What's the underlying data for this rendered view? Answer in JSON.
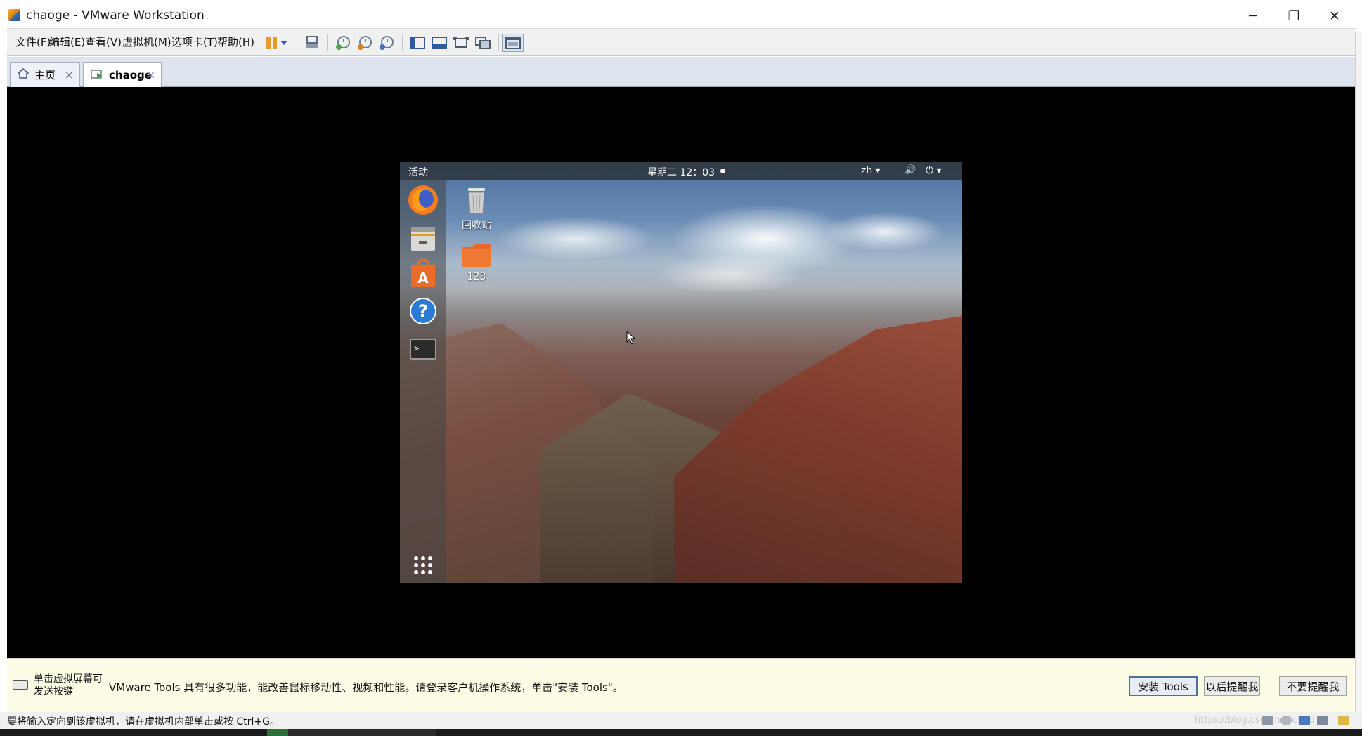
{
  "window": {
    "title": "chaoge - VMware Workstation",
    "controls": {
      "minimize": "─",
      "maximize": "❐",
      "close": "✕"
    }
  },
  "menu": [
    "文件(F)",
    "编辑(E)",
    "查看(V)",
    "虚拟机(M)",
    "选项卡(T)",
    "帮助(H)"
  ],
  "toolbar_icons": [
    "pause-icon",
    "dropdown-arrow-icon",
    "send-ctrl-alt-del-icon",
    "snapshot-take-icon",
    "snapshot-revert-icon",
    "snapshot-manager-icon",
    "library-view-icon",
    "thumbnail-bar-icon",
    "full-screen-icon",
    "unity-icon",
    "console-view-icon"
  ],
  "tabs": [
    {
      "label": "主页",
      "icon": "home-icon",
      "active": false
    },
    {
      "label": "chaoge",
      "icon": "vm-icon",
      "active": true
    }
  ],
  "guest": {
    "topbar": {
      "activities": "活动",
      "clock": "星期二 12：03",
      "input_method": "zh ▾",
      "volume": "🔊",
      "power": "⏻ ▾"
    },
    "dock": [
      "firefox-icon",
      "files-icon",
      "software-center-icon",
      "help-icon",
      "terminal-icon",
      "show-apps-icon"
    ],
    "desktop_icons": [
      {
        "label": "回收站",
        "icon": "trash-icon"
      },
      {
        "label": "123",
        "icon": "folder-icon"
      }
    ]
  },
  "notification": {
    "hint": "单击虚拟屏幕可发送按键",
    "message": "VMware Tools 具有很多功能，能改善鼠标移动性、视频和性能。请登录客户机操作系统，单击\"安装 Tools\"。",
    "buttons": {
      "install": "安装 Tools",
      "remind_later": "以后提醒我",
      "never": "不要提醒我"
    }
  },
  "status": {
    "text": "要将输入定向到该虚拟机，请在虚拟机内部单击或按 Ctrl+G。",
    "watermark": "https://blog.csdn.net/chao"
  },
  "colors": {
    "accent": "#e79a2c",
    "vm_background": "#000000",
    "notification_bg": "#fdfce6"
  }
}
